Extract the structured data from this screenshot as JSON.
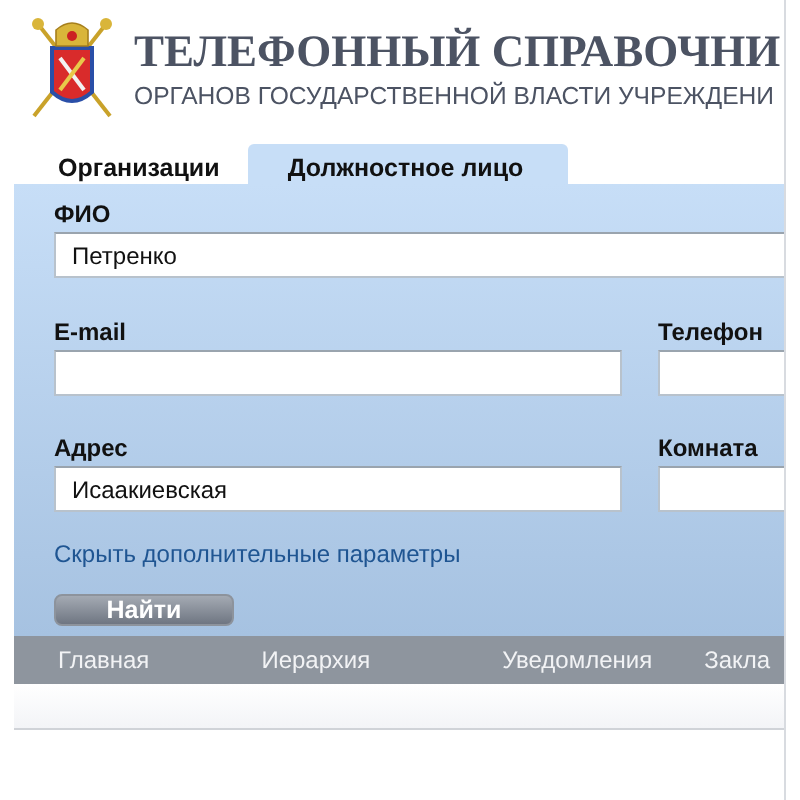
{
  "header": {
    "title": "ТЕЛЕФОННЫЙ СПРАВОЧНИ",
    "subtitle": "ОРГАНОВ ГОСУДАРСТВЕННОЙ ВЛАСТИ УЧРЕЖДЕНИ"
  },
  "tabs": [
    {
      "label": "Организации",
      "selected": false
    },
    {
      "label": "Должностное лицо",
      "selected": true
    }
  ],
  "form": {
    "fio": {
      "label": "ФИО",
      "value": "Петренко"
    },
    "rows": [
      [
        {
          "label": "E-mail"
        },
        {
          "label": "Телефон"
        }
      ],
      [
        {
          "label": "Адрес",
          "value": "Исаакиевская"
        },
        {
          "label": "Комната"
        }
      ]
    ],
    "toggle_link": "Скрыть дополнительные параметры",
    "search_button": "Найти"
  },
  "nav": [
    "Главная",
    "Иерархия",
    "Уведомления",
    "Закла"
  ]
}
